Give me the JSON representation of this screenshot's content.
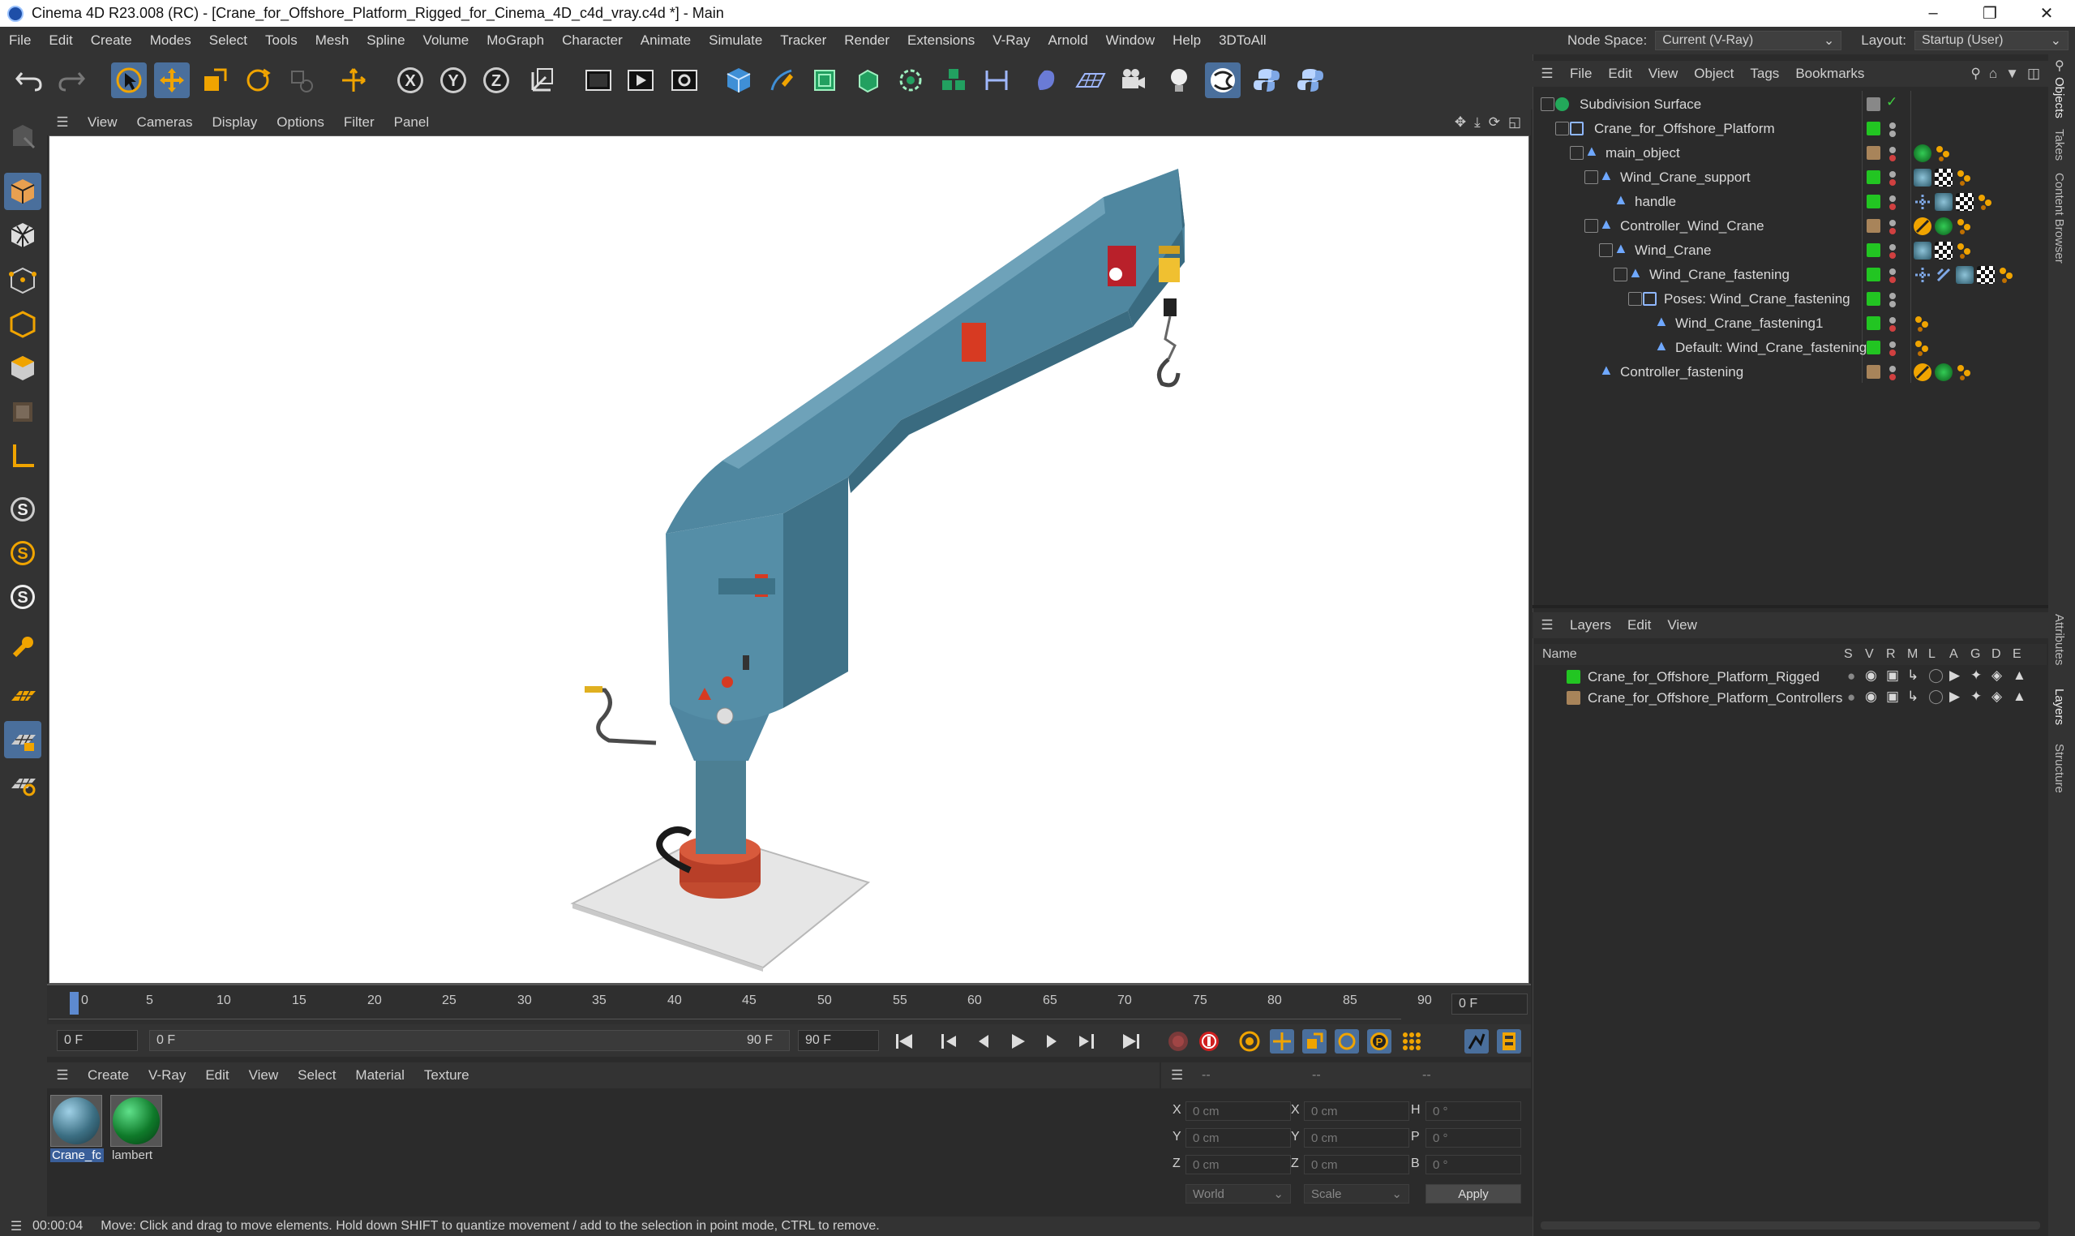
{
  "title_bar": {
    "title": "Cinema 4D R23.008 (RC) - [Crane_for_Offshore_Platform_Rigged_for_Cinema_4D_c4d_vray.c4d *] - Main"
  },
  "menu": [
    "File",
    "Edit",
    "Create",
    "Modes",
    "Select",
    "Tools",
    "Mesh",
    "Spline",
    "Volume",
    "MoGraph",
    "Character",
    "Animate",
    "Simulate",
    "Tracker",
    "Render",
    "Extensions",
    "V-Ray",
    "Arnold",
    "Window",
    "Help",
    "3DToAll"
  ],
  "node_space": {
    "label": "Node Space:",
    "value": "Current (V-Ray)"
  },
  "layout": {
    "label": "Layout:",
    "value": "Startup (User)"
  },
  "viewport_menu": [
    "View",
    "Cameras",
    "Display",
    "Options",
    "Filter",
    "Panel"
  ],
  "objects_menu": [
    "File",
    "Edit",
    "View",
    "Object",
    "Tags",
    "Bookmarks"
  ],
  "objects": [
    {
      "name": "Subdivision Surface"
    },
    {
      "name": "Crane_for_Offshore_Platform"
    },
    {
      "name": "main_object"
    },
    {
      "name": "Wind_Crane_support"
    },
    {
      "name": "handle"
    },
    {
      "name": "Controller_Wind_Crane"
    },
    {
      "name": "Wind_Crane"
    },
    {
      "name": "Wind_Crane_fastening"
    },
    {
      "name": "Poses: Wind_Crane_fastening"
    },
    {
      "name": "Wind_Crane_fastening1"
    },
    {
      "name": "Default: Wind_Crane_fastening"
    },
    {
      "name": "Controller_fastening"
    }
  ],
  "layers_menu": [
    "Layers",
    "Edit",
    "View"
  ],
  "layers_header": {
    "name": "Name",
    "cols": [
      "S",
      "V",
      "R",
      "M",
      "L",
      "A",
      "G",
      "D",
      "E"
    ]
  },
  "layers": [
    {
      "name": "Crane_for_Offshore_Platform_Rigged",
      "color": "#22c522"
    },
    {
      "name": "Crane_for_Offshore_Platform_Controllers",
      "color": "#a8845a"
    }
  ],
  "timeline": {
    "ticks": [
      "0",
      "5",
      "10",
      "15",
      "20",
      "25",
      "30",
      "35",
      "40",
      "45",
      "50",
      "55",
      "60",
      "65",
      "70",
      "75",
      "80",
      "85",
      "90"
    ],
    "current_frame": "0 F"
  },
  "transport": {
    "start": "0 F",
    "range_start": "0 F",
    "range_end": "90 F",
    "end": "90 F"
  },
  "material_menu": [
    "Create",
    "V-Ray",
    "Edit",
    "View",
    "Select",
    "Material",
    "Texture"
  ],
  "materials": [
    {
      "name": "Crane_fc",
      "color": "#3c6f83"
    },
    {
      "name": "lambert",
      "color": "#0f7a2a"
    }
  ],
  "coords": {
    "header": [
      "--",
      "--",
      "--"
    ],
    "rows": [
      {
        "a": "X",
        "av": "0 cm",
        "b": "X",
        "bv": "0 cm",
        "c": "H",
        "cv": "0 °"
      },
      {
        "a": "Y",
        "av": "0 cm",
        "b": "Y",
        "bv": "0 cm",
        "c": "P",
        "cv": "0 °"
      },
      {
        "a": "Z",
        "av": "0 cm",
        "b": "Z",
        "bv": "0 cm",
        "c": "B",
        "cv": "0 °"
      }
    ],
    "world": "World",
    "scale": "Scale",
    "apply": "Apply"
  },
  "status": {
    "time": "00:00:04",
    "message": "Move: Click and drag to move elements. Hold down SHIFT to quantize movement / add to the selection in point mode, CTRL to remove."
  },
  "side_tabs": [
    "Objects",
    "Takes",
    "Content Browser",
    "Attributes",
    "Layers",
    "Structure"
  ]
}
